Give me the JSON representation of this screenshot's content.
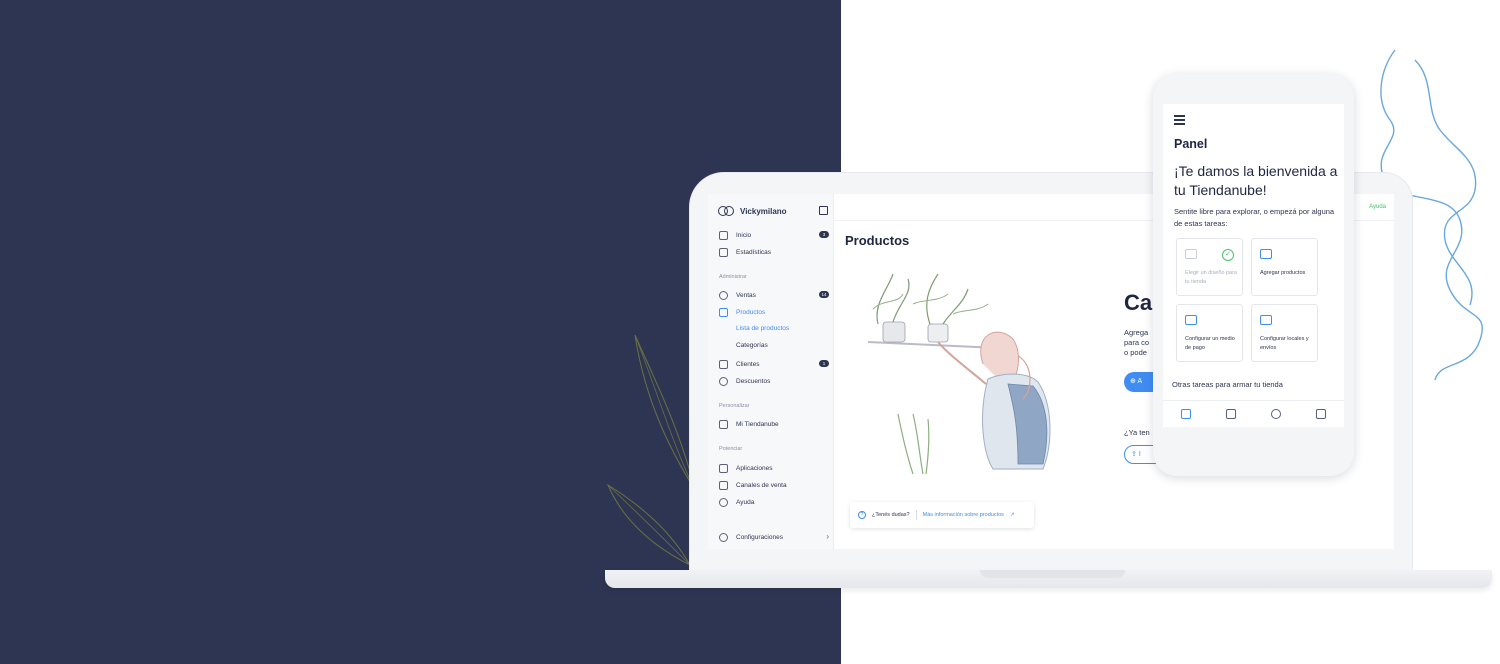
{
  "colors": {
    "dark_bg": "#2d3552",
    "accent": "#3f8cf2",
    "success": "#4ac26b",
    "text": "#1f2640"
  },
  "sidebar": {
    "store_name": "Vickymilano",
    "items": [
      {
        "label": "Inicio",
        "icon": "home-icon",
        "badge": "3"
      },
      {
        "label": "Estadísticas",
        "icon": "chart-icon"
      }
    ],
    "section_admin": "Administrar",
    "admin_items": [
      {
        "label": "Ventas",
        "icon": "dollar-icon",
        "badge": "14"
      },
      {
        "label": "Productos",
        "icon": "tag-icon"
      }
    ],
    "productos_sub": [
      "Lista de productos",
      "Categorías"
    ],
    "admin_items_2": [
      {
        "label": "Clientes",
        "icon": "users-icon",
        "badge": "1"
      },
      {
        "label": "Descuentos",
        "icon": "percent-icon"
      }
    ],
    "section_personalizar": "Personalizar",
    "personalizar_items": [
      {
        "label": "Mi Tiendanube",
        "icon": "brush-icon"
      }
    ],
    "section_potenciar": "Potenciar",
    "potenciar_items": [
      {
        "label": "Aplicaciones",
        "icon": "apps-icon"
      },
      {
        "label": "Canales de venta",
        "icon": "channels-icon"
      },
      {
        "label": "Ayuda",
        "icon": "help-icon"
      }
    ],
    "settings": {
      "label": "Configuraciones",
      "icon": "gear-icon"
    }
  },
  "main": {
    "help_link": "Ayuda",
    "page_title": "Productos",
    "big_title": "Ca",
    "description_lines": [
      "Agrega",
      "para co",
      "o pode"
    ],
    "primary_button": "A",
    "have_question": "¿Ya ten",
    "outline_button": "I",
    "help_card": {
      "question": "¿Tenés dudas?",
      "link": "Más información sobre productos"
    }
  },
  "phone": {
    "title": "Panel",
    "welcome": "¡Te damos la bienvenida a tu Tiendanube!",
    "subtitle": "Sentite libre para explorar, o empezá por alguna de estas tareas:",
    "tasks": [
      {
        "label": "Elegir un diseño para tu tienda",
        "icon": "brush-icon",
        "done": true
      },
      {
        "label": "Agregar productos",
        "icon": "tag-icon",
        "done": false
      },
      {
        "label": "Configurar un medio de pago",
        "icon": "credit-card-icon",
        "done": false
      },
      {
        "label": "Configurar locales y envíos",
        "icon": "truck-icon",
        "done": false
      }
    ],
    "more_tasks": "Otras tareas para armar tu tienda",
    "tabs": [
      "home-icon",
      "chart-icon",
      "dollar-icon",
      "tag-icon"
    ]
  }
}
